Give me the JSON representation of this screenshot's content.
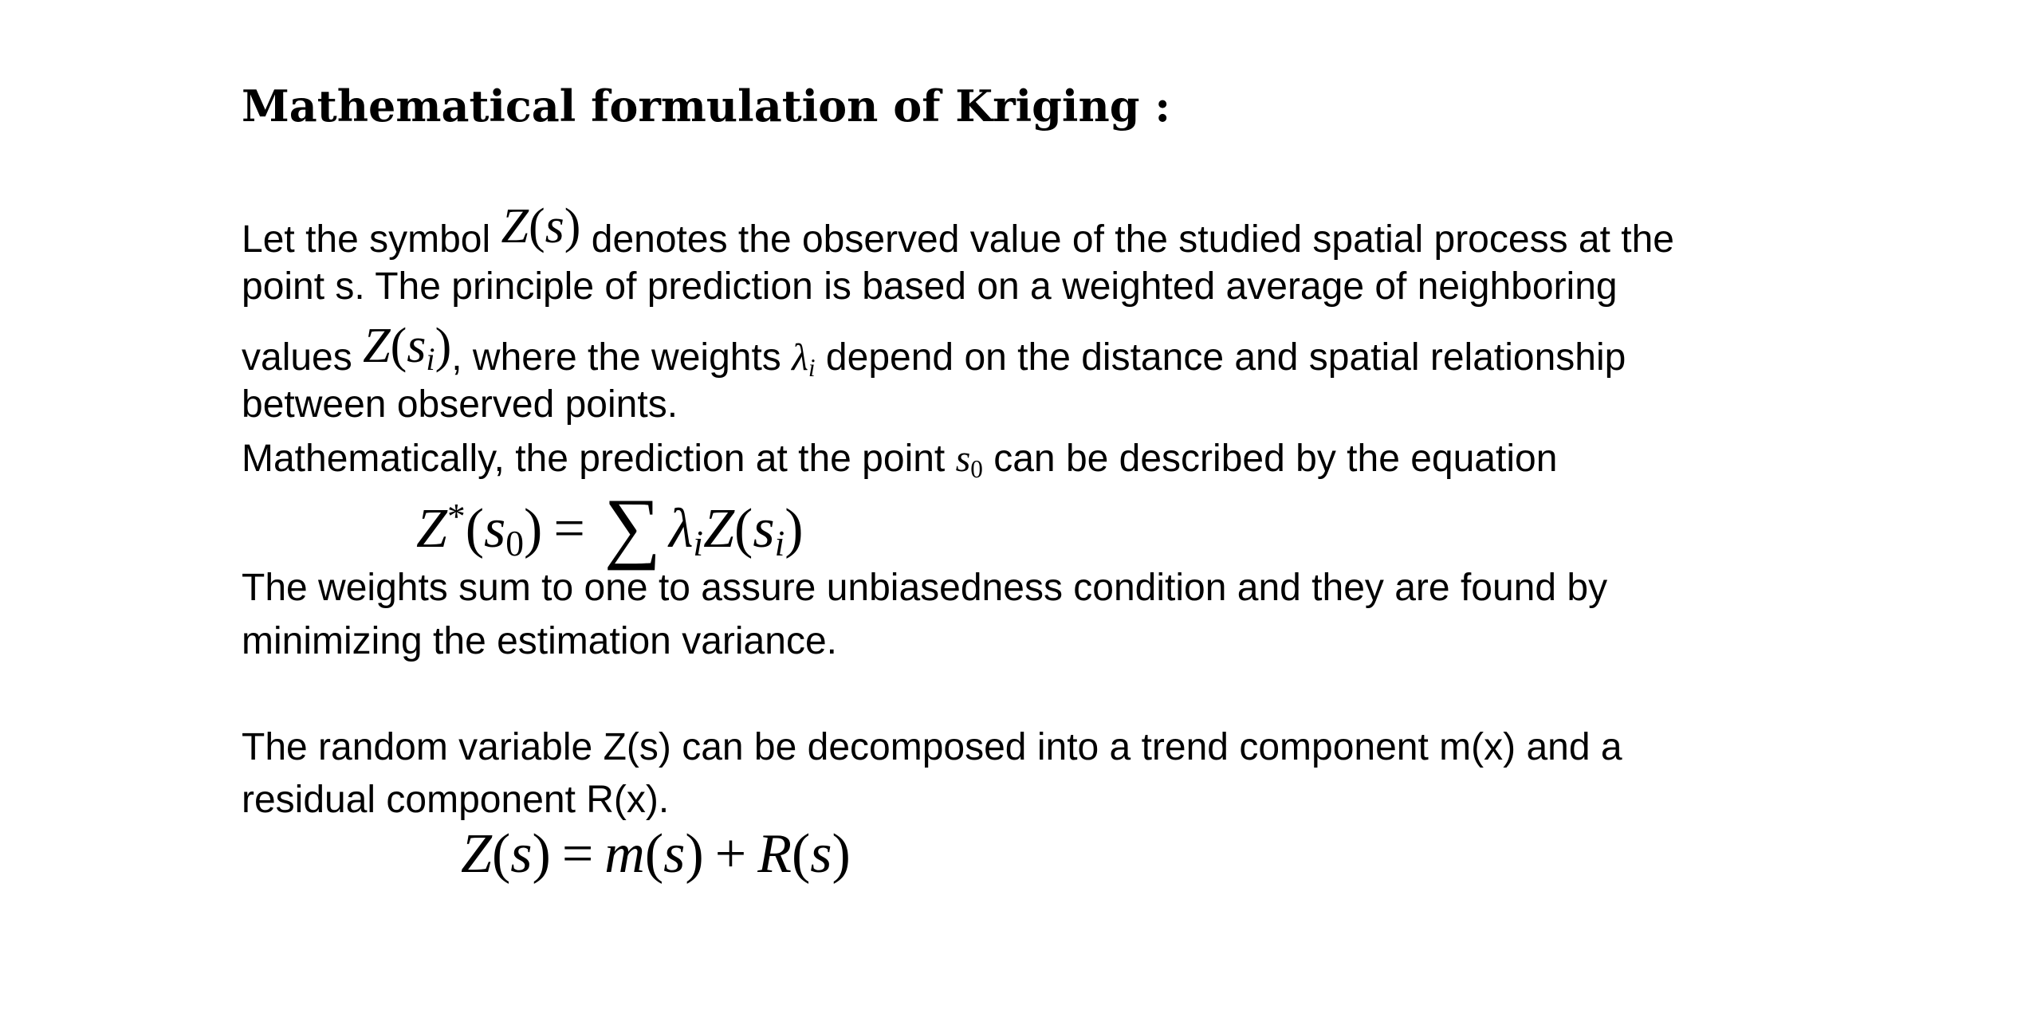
{
  "title": "Mathematical formulation of Kriging :",
  "paragraph1": {
    "line1_a": "Let the symbol ",
    "line1_b": " denotes the observed value of the studied spatial process at the",
    "line2": "point s. The principle of prediction is based on a weighted average of neighboring",
    "line3_a": "values ",
    "line3_b": ", where the weights ",
    "line3_c": " depend on the distance and spatial relationship",
    "line4": "between observed points.",
    "line5_a": "Mathematically, the prediction at the point ",
    "line5_b": " can be described by the equation"
  },
  "paragraph2": {
    "line1": "The weights sum to one to assure unbiasedness condition and they are found by",
    "line2": "minimizing the estimation variance."
  },
  "paragraph3": {
    "line1": "The random variable Z(s) can be decomposed into a trend component m(x) and a",
    "line2": "residual component R(x)."
  },
  "math": {
    "Z": "Z",
    "s": "s",
    "i": "i",
    "zero": "0",
    "lambda": "λ",
    "star": "*",
    "lparen": "(",
    "rparen": ")",
    "equals": "=",
    "sigma": "∑",
    "plus": "+",
    "m": "m",
    "R": "R"
  }
}
